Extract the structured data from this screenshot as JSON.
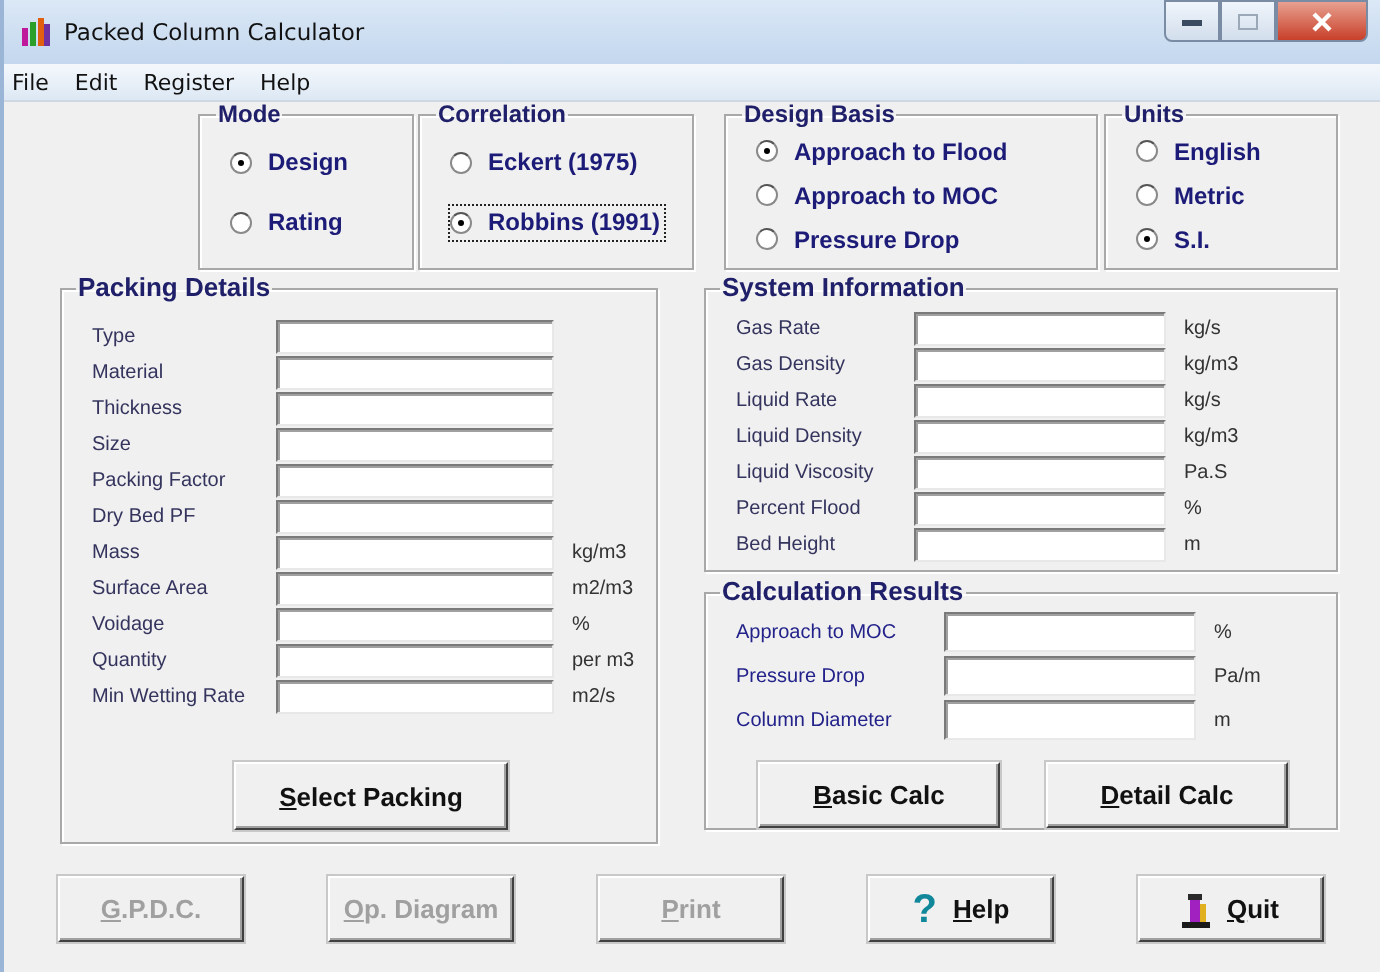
{
  "window": {
    "title": "Packed Column Calculator"
  },
  "menu": [
    "File",
    "Edit",
    "Register",
    "Help"
  ],
  "option_groups": [
    {
      "title": "Mode",
      "options": [
        {
          "label": "Design",
          "selected": true,
          "focused": false
        },
        {
          "label": "Rating",
          "selected": false,
          "focused": false
        }
      ]
    },
    {
      "title": "Correlation",
      "options": [
        {
          "label": "Eckert (1975)",
          "selected": false,
          "focused": false
        },
        {
          "label": "Robbins (1991)",
          "selected": true,
          "focused": true
        }
      ]
    },
    {
      "title": "Design Basis",
      "options": [
        {
          "label": "Approach to Flood",
          "selected": true,
          "focused": false
        },
        {
          "label": "Approach to MOC",
          "selected": false,
          "focused": false
        },
        {
          "label": "Pressure Drop",
          "selected": false,
          "focused": false
        }
      ]
    },
    {
      "title": "Units",
      "options": [
        {
          "label": "English",
          "selected": false,
          "focused": false
        },
        {
          "label": "Metric",
          "selected": false,
          "focused": false
        },
        {
          "label": "S.I.",
          "selected": true,
          "focused": false
        }
      ]
    }
  ],
  "packing_details": {
    "title": "Packing Details",
    "fields": [
      {
        "label": "Type"
      },
      {
        "label": "Material"
      },
      {
        "label": "Thickness"
      },
      {
        "label": "Size"
      },
      {
        "label": "Packing Factor"
      },
      {
        "label": "Dry Bed PF"
      },
      {
        "label": "Mass",
        "unit": "kg/m3"
      },
      {
        "label": "Surface Area",
        "unit": "m2/m3"
      },
      {
        "label": "Voidage",
        "unit": "%"
      },
      {
        "label": "Quantity",
        "unit": "per m3"
      },
      {
        "label": "Min Wetting Rate",
        "unit": "m2/s"
      }
    ],
    "button": {
      "mnemonic": "S",
      "rest": "elect Packing"
    }
  },
  "system_information": {
    "title": "System Information",
    "fields": [
      {
        "label": "Gas Rate",
        "unit": "kg/s"
      },
      {
        "label": "Gas Density",
        "unit": "kg/m3"
      },
      {
        "label": "Liquid Rate",
        "unit": "kg/s"
      },
      {
        "label": "Liquid Density",
        "unit": "kg/m3"
      },
      {
        "label": "Liquid Viscosity",
        "unit": "Pa.S"
      },
      {
        "label": "Percent Flood",
        "unit": "%"
      },
      {
        "label": "Bed Height",
        "unit": "m"
      }
    ]
  },
  "calculation_results": {
    "title": "Calculation Results",
    "fields": [
      {
        "label": "Approach to MOC",
        "unit": "%"
      },
      {
        "label": "Pressure Drop",
        "unit": "Pa/m"
      },
      {
        "label": "Column Diameter",
        "unit": "m"
      }
    ],
    "buttons": [
      {
        "mnemonic": "B",
        "rest": "asic Calc"
      },
      {
        "mnemonic": "D",
        "rest": "etail Calc"
      }
    ]
  },
  "bottom_buttons": [
    {
      "kind": "plain",
      "mnemonic": "G",
      "rest": ".P.D.C.",
      "disabled": true
    },
    {
      "kind": "plain",
      "mnemonic": "O",
      "rest": "p. Diagram",
      "disabled": true
    },
    {
      "kind": "plain",
      "mnemonic": "P",
      "rest": "rint",
      "disabled": true
    },
    {
      "kind": "help",
      "glyph": "?",
      "mnemonic": "H",
      "rest": "elp",
      "disabled": false
    },
    {
      "kind": "quit",
      "mnemonic": "Q",
      "rest": "uit",
      "disabled": false
    }
  ]
}
